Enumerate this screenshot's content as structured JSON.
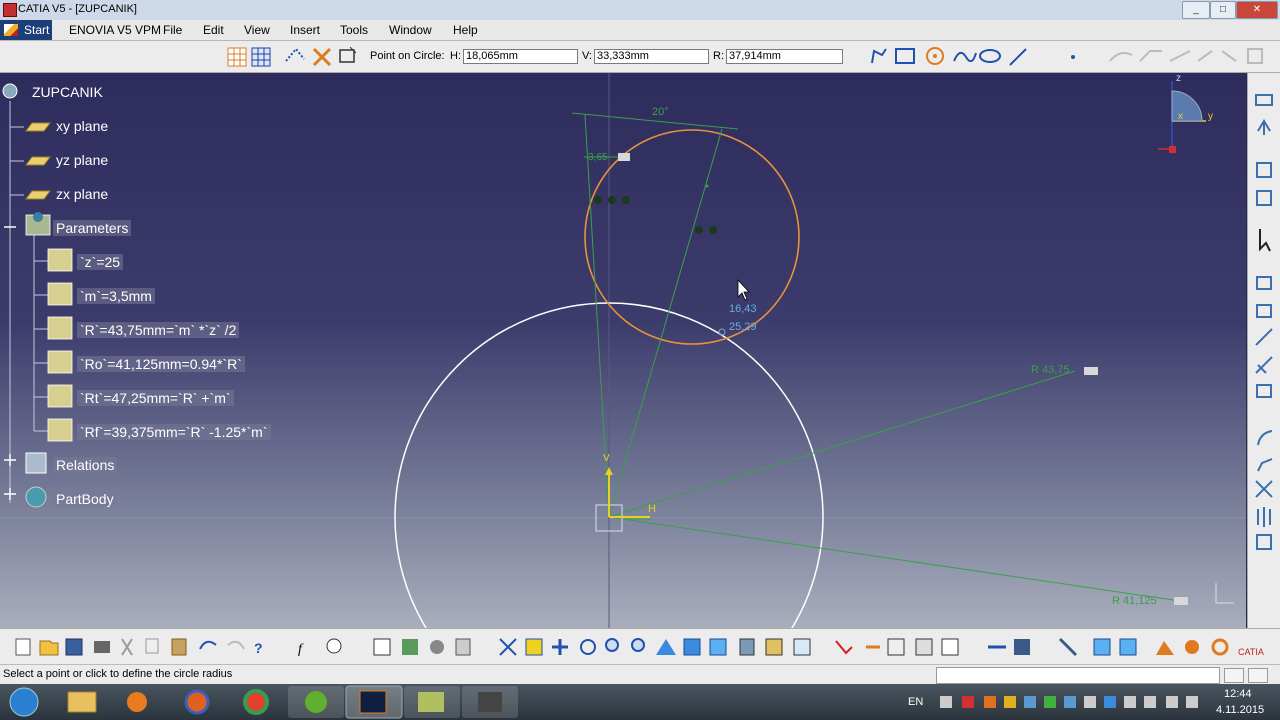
{
  "window": {
    "title": "CATIA V5 - [ZUPCANIK]",
    "min": "_",
    "max": "□",
    "close": "✕"
  },
  "menu": {
    "start": "Start",
    "items": [
      "ENOVIA V5 VPM",
      "File",
      "Edit",
      "View",
      "Insert",
      "Tools",
      "Window",
      "Help"
    ]
  },
  "sketch_tools": {
    "label": "Point on Circle:",
    "h_label": "H:",
    "h_value": "18,065mm",
    "v_label": "V:",
    "v_value": "33,333mm",
    "r_label": "R:",
    "r_value": "37,914mm"
  },
  "tree": {
    "root": "ZUPCANIK",
    "planes": [
      "xy plane",
      "yz plane",
      "zx plane"
    ],
    "parameters_label": "Parameters",
    "parameters": [
      "`z`=25",
      "`m`=3,5mm",
      "`R`=43,75mm=`m` *`z` /2",
      "`Ro`=41,125mm=0.94*`R`",
      "`Rt`=47,25mm=`R` +`m`",
      "`Rf`=39,375mm=`R` -1.25*`m`"
    ],
    "relations": "Relations",
    "partbody": "PartBody"
  },
  "sketch": {
    "angle_dim": "20°",
    "small_dim": "3,65",
    "cursor_readout_1": "16,43",
    "cursor_readout_2": "25,29",
    "dim_r1": "R 43,75",
    "dim_r2": "R 41,125",
    "axis_h": "H",
    "axis_v": "V",
    "compass_x": "x",
    "compass_y": "y",
    "compass_z": "z"
  },
  "status": {
    "message": "Select a point or click to define the circle radius"
  },
  "taskbar": {
    "lang": "EN",
    "time": "12:44",
    "date": "4.11.2015"
  },
  "colors": {
    "accent_circle": "#e8923a",
    "sketch_line": "#3aa04a",
    "viewport_top": "#2e2c5c"
  }
}
